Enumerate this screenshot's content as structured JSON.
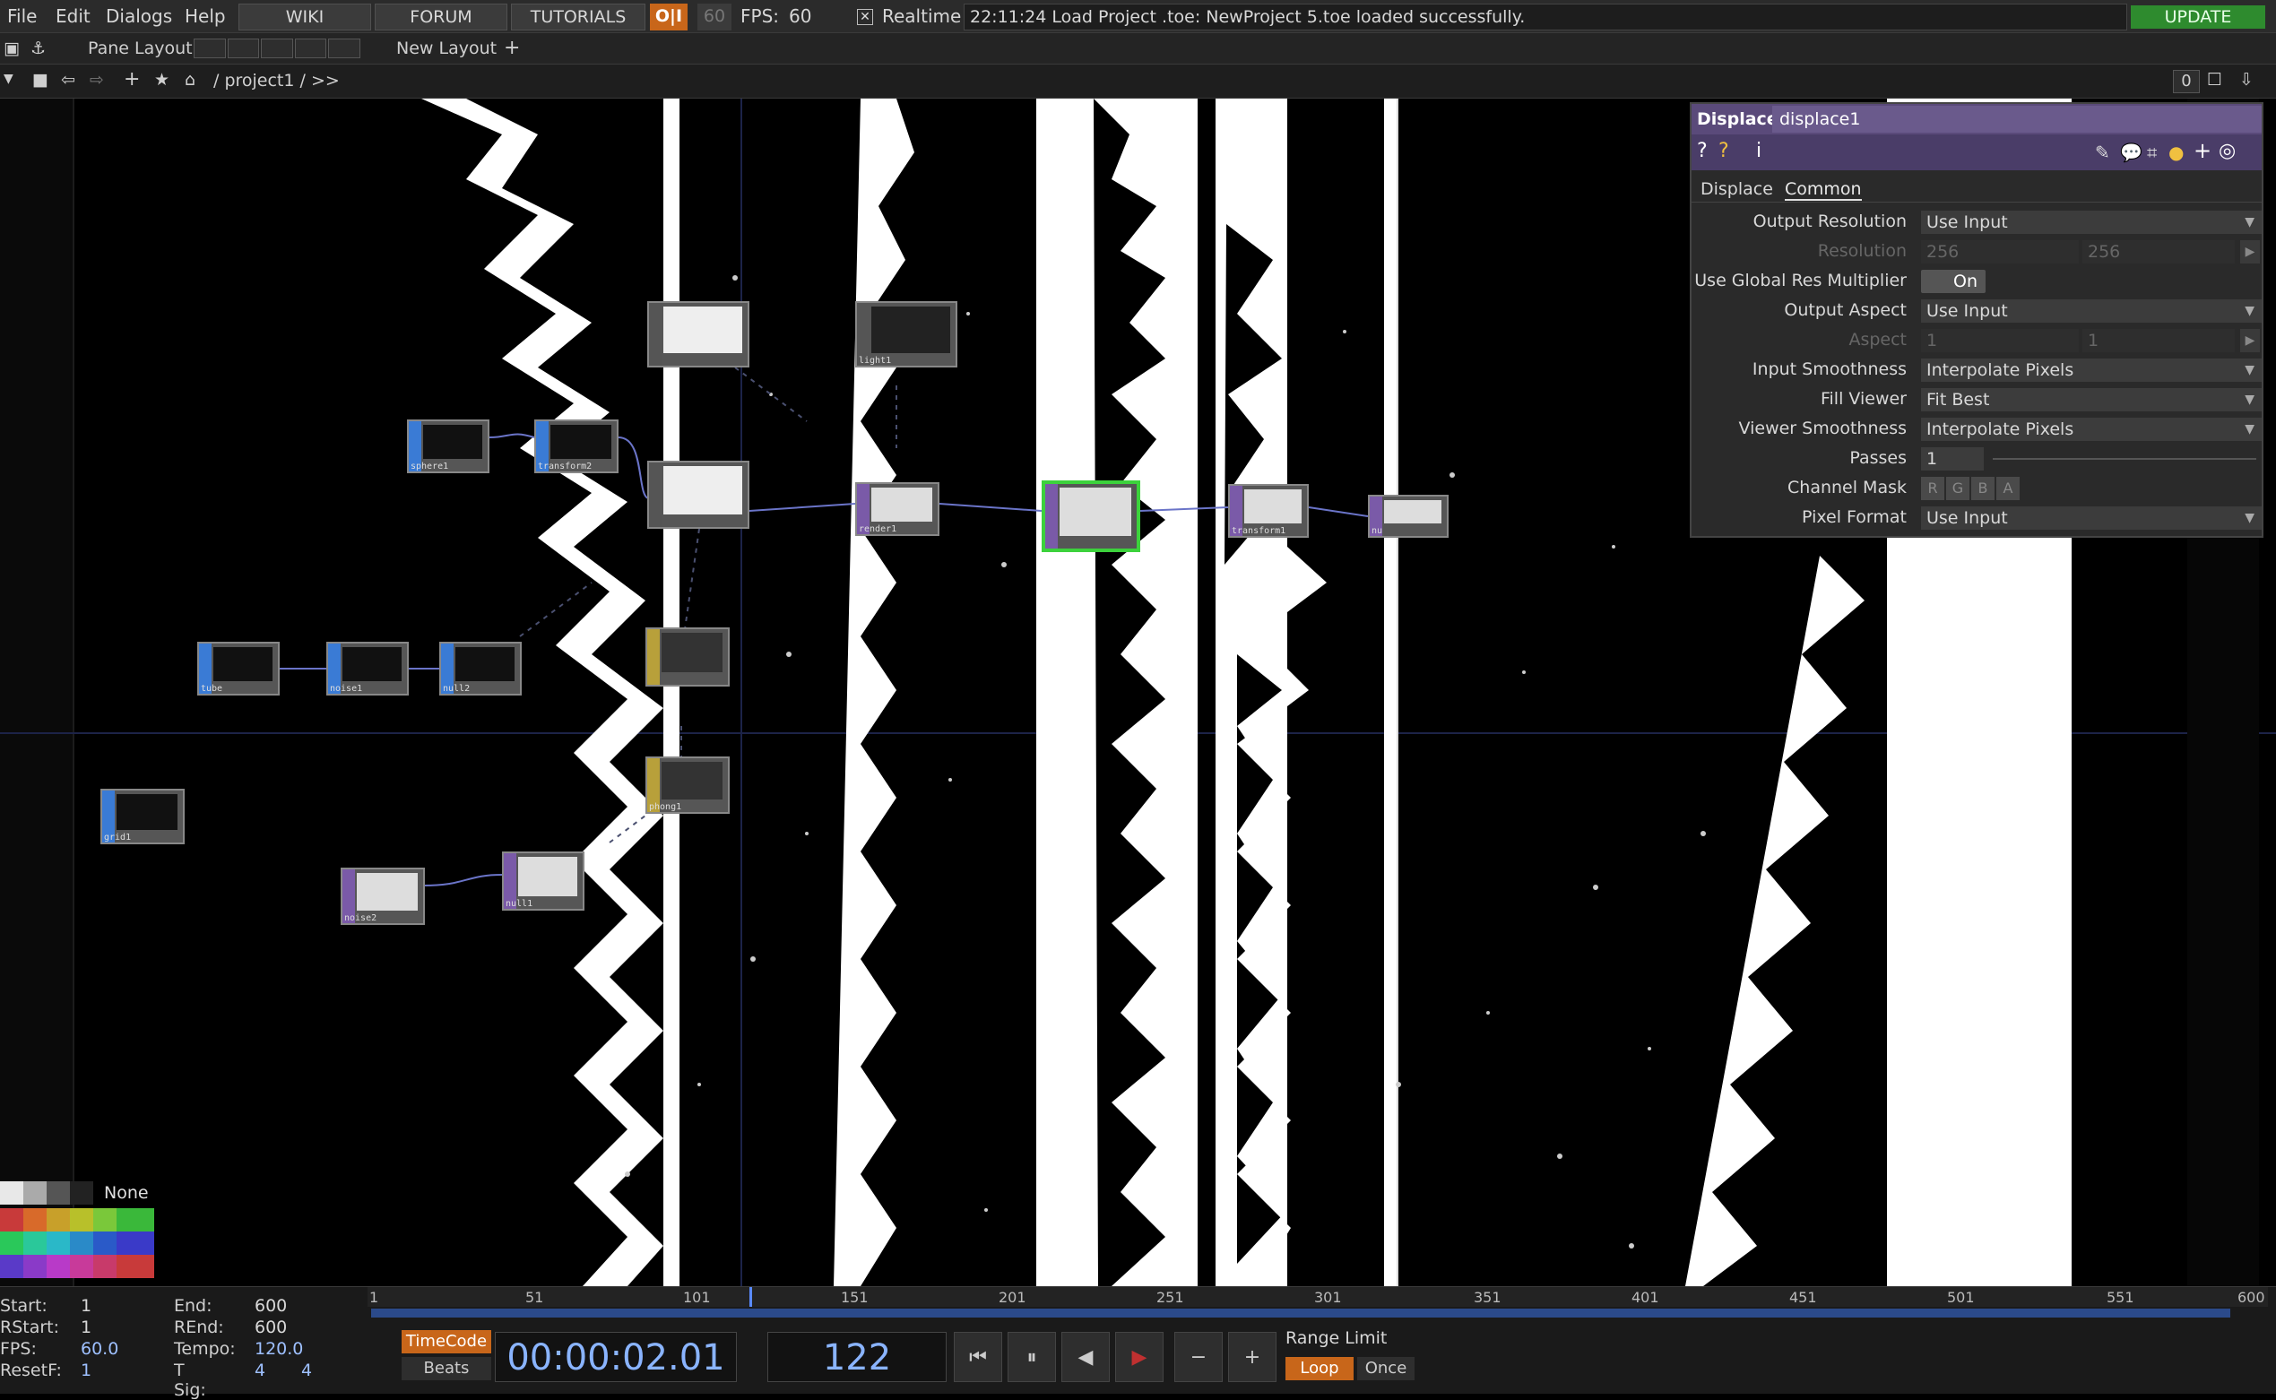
{
  "menubar": {
    "items": [
      "File",
      "Edit",
      "Dialogs",
      "Help"
    ],
    "buttons": [
      "WIKI",
      "FORUM",
      "TUTORIALS"
    ],
    "oi_label": "O|I",
    "fps_cap": "60",
    "fps_label": "FPS:",
    "fps_value": "60",
    "realtime_label": "Realtime",
    "status_message": "22:11:24 Load Project .toe: NewProject 5.toe loaded successfully.",
    "update_label": "UPDATE"
  },
  "toolbar": {
    "pane_layout_label": "Pane Layout",
    "new_layout_label": "New Layout",
    "path": "/ project1 / >>",
    "counter": "0"
  },
  "nodes": [
    {
      "id": "sphere1",
      "label": "sphere1"
    },
    {
      "id": "transform2",
      "label": "transform2"
    },
    {
      "id": "tube",
      "label": "tube"
    },
    {
      "id": "noise1",
      "label": "noise1"
    },
    {
      "id": "null2",
      "label": "null2"
    },
    {
      "id": "grid1",
      "label": "grid1"
    },
    {
      "id": "noise2",
      "label": "noise2"
    },
    {
      "id": "null1",
      "label": "null1"
    },
    {
      "id": "geo",
      "label": ""
    },
    {
      "id": "light1",
      "label": "light1"
    },
    {
      "id": "geo2",
      "label": ""
    },
    {
      "id": "render1",
      "label": "render1"
    },
    {
      "id": "displace1",
      "label": ""
    },
    {
      "id": "transform1",
      "label": "transform1"
    },
    {
      "id": "null3",
      "label": "nu"
    },
    {
      "id": "yellow1",
      "label": ""
    },
    {
      "id": "yellow2",
      "label": "phong1"
    }
  ],
  "panel": {
    "op_type": "Displace",
    "op_name": "displace1",
    "tabs": [
      "Displace",
      "Common"
    ],
    "active_tab": "Common",
    "params": [
      {
        "label": "Output Resolution",
        "value": "Use Input",
        "dim": false
      },
      {
        "label": "Resolution",
        "value": "256",
        "value2": "256",
        "dim": true
      },
      {
        "label": "Use Global Res Multiplier",
        "value": "On",
        "toggle": true
      },
      {
        "label": "Output Aspect",
        "value": "Use Input",
        "dim": false
      },
      {
        "label": "Aspect",
        "value": "1",
        "value2": "1",
        "dim": true
      },
      {
        "label": "Input Smoothness",
        "value": "Interpolate Pixels",
        "dim": false
      },
      {
        "label": "Fill Viewer",
        "value": "Fit Best",
        "dim": false
      },
      {
        "label": "Viewer Smoothness",
        "value": "Interpolate Pixels",
        "dim": false
      },
      {
        "label": "Passes",
        "value": "1",
        "slider": true
      },
      {
        "label": "Channel Mask",
        "value": "R G B A",
        "channels": [
          "R",
          "G",
          "B",
          "A"
        ]
      },
      {
        "label": "Pixel Format",
        "value": "Use Input",
        "dim": false
      }
    ]
  },
  "palette": {
    "none_label": "None"
  },
  "timeline": {
    "ticks": [
      "1",
      "51",
      "101",
      "151",
      "201",
      "251",
      "301",
      "351",
      "401",
      "451",
      "501",
      "551",
      "600"
    ],
    "start": "1",
    "end": "600",
    "rstart": "1",
    "rend": "600",
    "fps": "60.0",
    "tempo": "120.0",
    "resetf": "1",
    "tsig_a": "4",
    "tsig_b": "4",
    "labels": {
      "start": "Start:",
      "end": "End:",
      "rstart": "RStart:",
      "rend": "REnd:",
      "fps": "FPS:",
      "tempo": "Tempo:",
      "resetf": "ResetF:",
      "tsig": "T Sig:"
    },
    "timecode_label": "TimeCode",
    "beats_label": "Beats",
    "timecode": "00:00:02.01",
    "frame": "122",
    "range_limit_label": "Range Limit",
    "loop_label": "Loop",
    "once_label": "Once",
    "current_frame": 122,
    "total_frames": 600
  }
}
